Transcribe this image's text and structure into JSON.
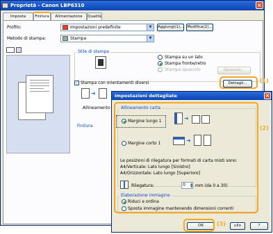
{
  "window": {
    "title": "Proprietà - Canon LBP6310",
    "close": "×"
  },
  "tabs": [
    {
      "label": "Imposta pagina"
    },
    {
      "label": "Finitura"
    },
    {
      "label": "Alimentazione carta"
    },
    {
      "label": "Qualità"
    }
  ],
  "profile": {
    "label": "Profilo:",
    "value": "Impostazioni predefinite",
    "add": "Aggiungi(1)...",
    "modify": "Modifica(2)..."
  },
  "print_method": {
    "label": "Metodo di stampa:",
    "value": "Stampa"
  },
  "print_style": {
    "title": "Stile di stampa",
    "options": [
      "Stampa su un lato",
      "Stampa fronte/retro",
      "Stampa opuscolo"
    ],
    "selected": 1,
    "opuscolo_button": "Opuscolo..."
  },
  "mixed_orientation": {
    "label": "Stampa con orientamenti diversi",
    "checked": true
  },
  "details_button": "Dettagli...",
  "paper_alignment_short": "Allineamento carta:",
  "finishing_label": "Finitura",
  "callouts": [
    "(1)",
    "(2)",
    "(3)"
  ],
  "dialog": {
    "title": "Impostazioni dettagliate",
    "close": "×",
    "alignment_group": "Allineamento carta",
    "long_edge": "Margine lungo 1",
    "short_edge": "Margine corto 1",
    "selected": "long",
    "info_line1": "Le posizioni di rilegatura per formati di carta misti sono:",
    "info_line2": "A4/Verticale: Lato lungo [Sinistro]",
    "info_line3": "A4/Orizzontale: Lato lungo [Superiore]",
    "gutter_label": "Rilegatura:",
    "gutter_value": "0",
    "gutter_unit": "mm (da 0 a 30)",
    "image_group": "Elaborazione immagine",
    "image_options": [
      "Riduci e ordina",
      "Sposta immagine mantenendo dimensioni correnti"
    ],
    "image_selected": 0,
    "ok": "OK",
    "cancel_partial": "ullo",
    "help": "?"
  }
}
